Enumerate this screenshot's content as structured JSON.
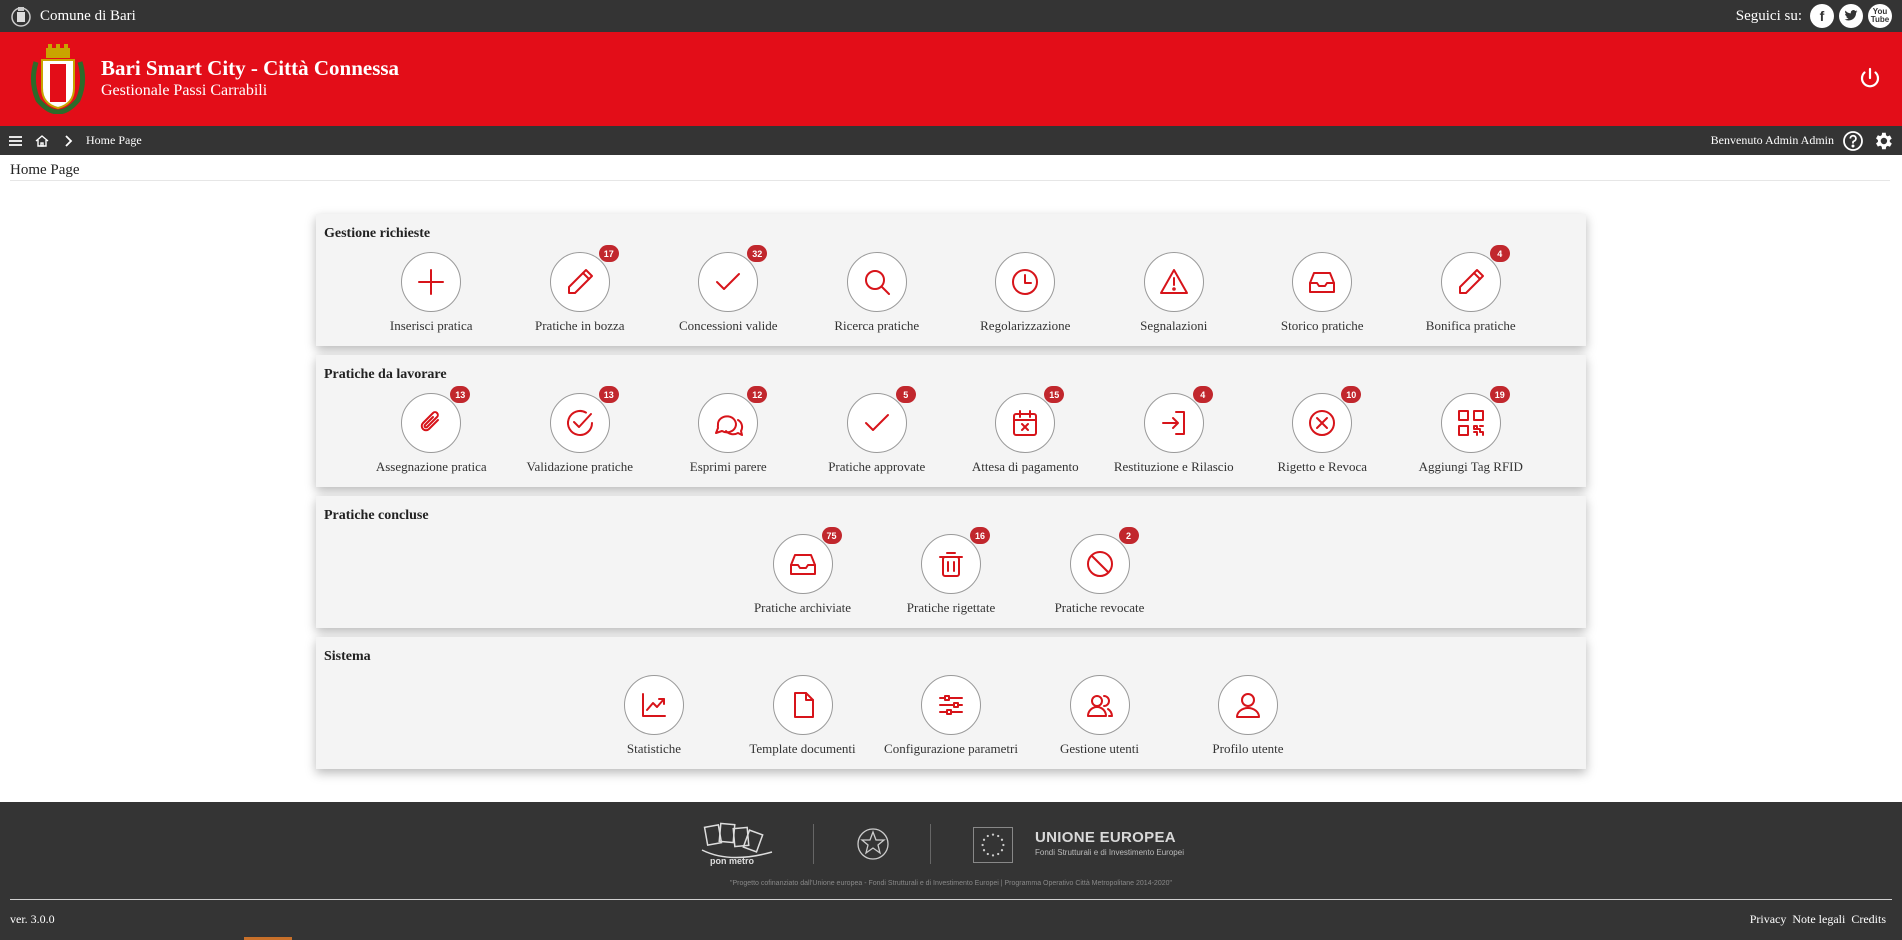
{
  "topbar": {
    "municipality": "Comune di Bari",
    "follow_label": "Seguici su:",
    "social": [
      "facebook-icon",
      "twitter-icon",
      "youtube-icon"
    ],
    "youtube_text_top": "You",
    "youtube_text_bottom": "Tube",
    "facebook_glyph": "f"
  },
  "header": {
    "title": "Bari Smart City - Città Connessa",
    "subtitle": "Gestionale Passi Carrabili",
    "color": "#e30d18"
  },
  "navbar": {
    "breadcrumb_current": "Home Page",
    "welcome": "Benvenuto Admin Admin"
  },
  "page": {
    "title": "Home Page"
  },
  "sections": [
    {
      "title": "Gestione richieste",
      "tiles": [
        {
          "label": "Inserisci pratica",
          "icon": "plus-icon",
          "badge": ""
        },
        {
          "label": "Pratiche in bozza",
          "icon": "pencil-icon",
          "badge": "17"
        },
        {
          "label": "Concessioni valide",
          "icon": "check-icon",
          "badge": "32"
        },
        {
          "label": "Ricerca pratiche",
          "icon": "search-icon",
          "badge": ""
        },
        {
          "label": "Regolarizzazione",
          "icon": "clock-icon",
          "badge": ""
        },
        {
          "label": "Segnalazioni",
          "icon": "warning-icon",
          "badge": ""
        },
        {
          "label": "Storico pratiche",
          "icon": "inbox-icon",
          "badge": ""
        },
        {
          "label": "Bonifica pratiche",
          "icon": "pencil-icon",
          "badge": "4"
        }
      ]
    },
    {
      "title": "Pratiche da lavorare",
      "tiles": [
        {
          "label": "Assegnazione pratica",
          "icon": "paperclip-icon",
          "badge": "13"
        },
        {
          "label": "Validazione pratiche",
          "icon": "check-circle-icon",
          "badge": "13"
        },
        {
          "label": "Esprimi parere",
          "icon": "chat-icon",
          "badge": "12"
        },
        {
          "label": "Pratiche approvate",
          "icon": "check-icon",
          "badge": "5"
        },
        {
          "label": "Attesa di pagamento",
          "icon": "calendar-x-icon",
          "badge": "15"
        },
        {
          "label": "Restituzione e Rilascio",
          "icon": "login-icon",
          "badge": "4"
        },
        {
          "label": "Rigetto e Revoca",
          "icon": "x-circle-icon",
          "badge": "10"
        },
        {
          "label": "Aggiungi Tag RFID",
          "icon": "qrcode-icon",
          "badge": "19"
        }
      ]
    },
    {
      "title": "Pratiche concluse",
      "tiles": [
        {
          "label": "Pratiche archiviate",
          "icon": "inbox-icon",
          "badge": "75"
        },
        {
          "label": "Pratiche rigettate",
          "icon": "trash-icon",
          "badge": "16"
        },
        {
          "label": "Pratiche revocate",
          "icon": "ban-icon",
          "badge": "2"
        }
      ]
    },
    {
      "title": "Sistema",
      "tiles": [
        {
          "label": "Statistiche",
          "icon": "chart-icon",
          "badge": ""
        },
        {
          "label": "Template documenti",
          "icon": "document-icon",
          "badge": ""
        },
        {
          "label": "Configurazione parametri",
          "icon": "sliders-icon",
          "badge": ""
        },
        {
          "label": "Gestione utenti",
          "icon": "users-icon",
          "badge": ""
        },
        {
          "label": "Profilo utente",
          "icon": "user-icon",
          "badge": ""
        }
      ]
    }
  ],
  "footer": {
    "eu_title": "UNIONE EUROPEA",
    "eu_subtitle": "Fondi Strutturali e di Investimento Europei",
    "disclaimer": "\"Progetto cofinanziato dall'Unione europea - Fondi Strutturali e di Investimento Europei | Programma Operativo Città Metropolitane 2014-2020\"",
    "pon_logo_text": "pon metro",
    "version": "ver. 3.0.0",
    "links": [
      "Privacy",
      "Note legali",
      "Credits"
    ]
  },
  "colors": {
    "accent": "#d7141a",
    "badge": "#c1272d",
    "dark": "#343434"
  }
}
